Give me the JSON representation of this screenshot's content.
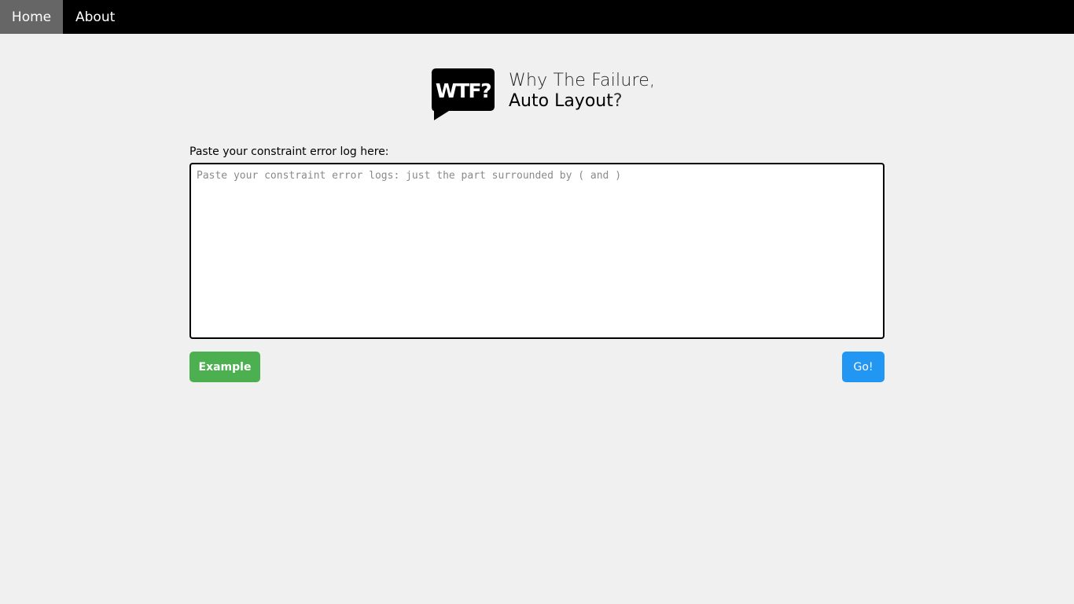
{
  "nav": {
    "items": [
      {
        "label": "Home",
        "active": true
      },
      {
        "label": "About",
        "active": false
      }
    ]
  },
  "brand": {
    "logo_text": "WTF?",
    "line1": "Why The Failure,",
    "line2": "Auto Layout",
    "line2_suffix": "?"
  },
  "form": {
    "label": "Paste your constraint error log here:",
    "placeholder": "Paste your constraint error logs: just the part surrounded by ( and )",
    "value": ""
  },
  "buttons": {
    "example_label": "Example",
    "go_label": "Go!"
  },
  "colors": {
    "navbar": "#000000",
    "nav_active": "#666666",
    "background": "#f0f0f0",
    "example_button": "#4caf50",
    "go_button": "#2196f3"
  }
}
